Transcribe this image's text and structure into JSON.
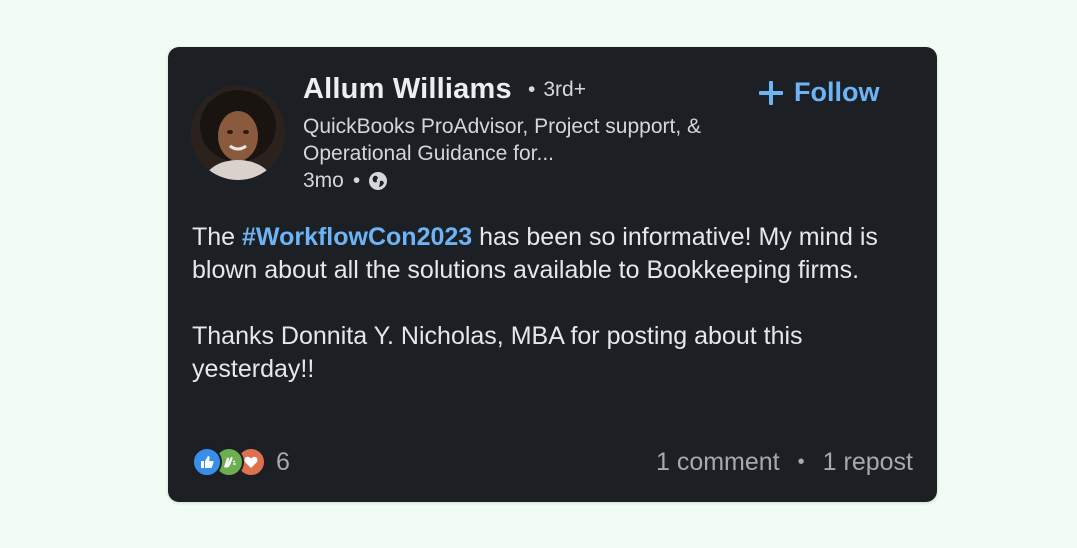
{
  "author": {
    "name": "Allum Williams",
    "degree": "3rd+",
    "headline": "QuickBooks ProAdvisor, Project support, & Operational Guidance for...",
    "time": "3mo",
    "visibility_icon": "globe-icon"
  },
  "follow": {
    "label": "Follow",
    "icon": "plus-icon"
  },
  "post": {
    "text_before": "The ",
    "hashtag": "#WorkflowCon2023",
    "text_after": " has been so informative! My mind is blown about all the solutions available to Bookkeeping firms.",
    "paragraph2": "Thanks Donnita Y. Nicholas, MBA for posting about this yesterday!!"
  },
  "social": {
    "reaction_icons": [
      "like-icon",
      "celebrate-icon",
      "love-icon"
    ],
    "reaction_count": "6",
    "comments": "1 comment",
    "reposts": "1 repost"
  },
  "colors": {
    "page_bg": "#f1fdf4",
    "card_bg": "#1c1f24",
    "accent": "#6cb4f6",
    "like": "#378fe9",
    "celebrate": "#6dae4f",
    "love": "#df704d"
  }
}
